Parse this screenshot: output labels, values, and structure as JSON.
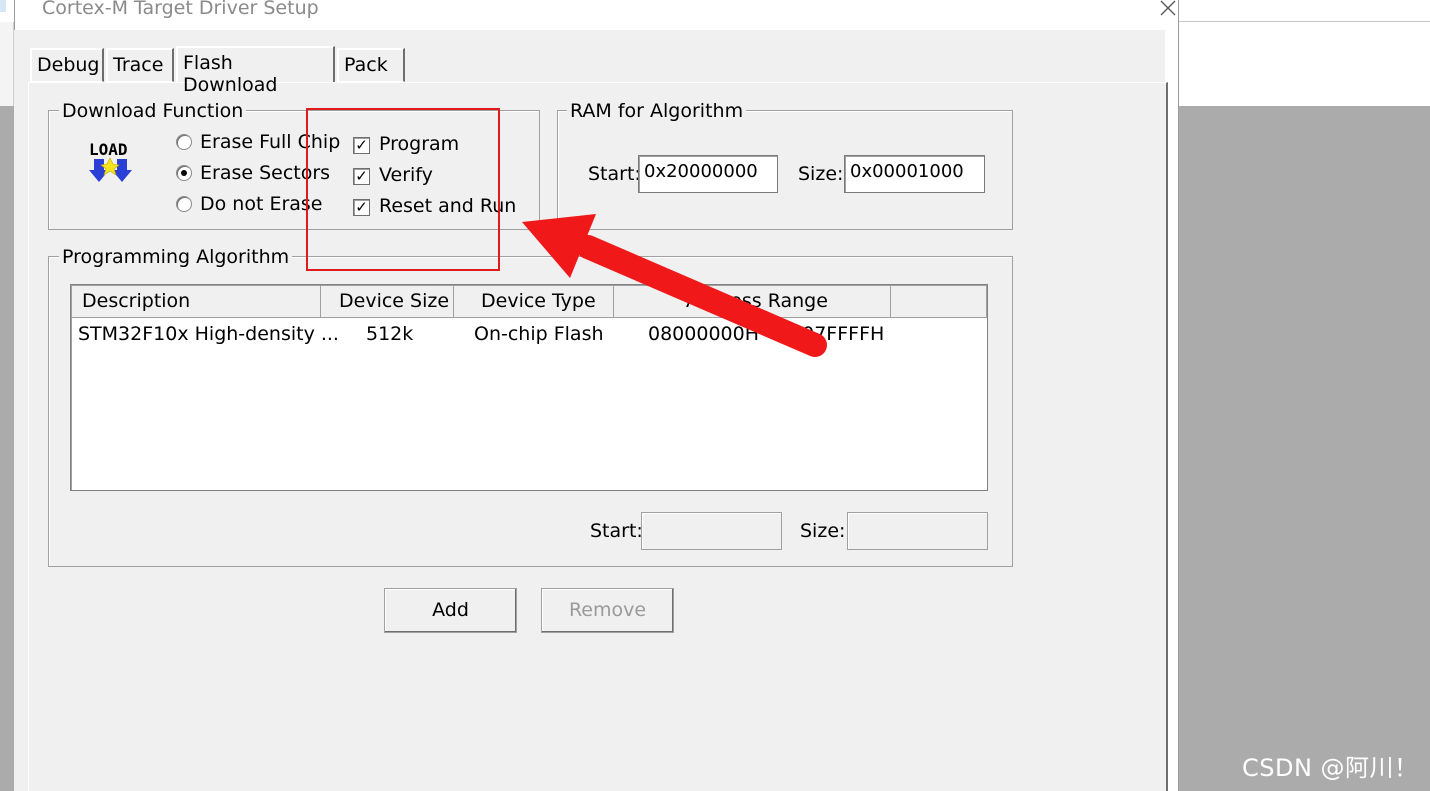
{
  "window": {
    "title": "Cortex-M Target Driver Setup"
  },
  "tabs": [
    {
      "label": "Debug"
    },
    {
      "label": "Trace"
    },
    {
      "label": "Flash Download"
    },
    {
      "label": "Pack"
    }
  ],
  "download_function": {
    "label": "Download Function",
    "icon_text": "LOAD",
    "radios": [
      {
        "label": "Erase Full Chip",
        "selected": false
      },
      {
        "label": "Erase Sectors",
        "selected": true
      },
      {
        "label": "Do not Erase",
        "selected": false
      }
    ],
    "checkboxes": [
      {
        "label": "Program",
        "checked": true
      },
      {
        "label": "Verify",
        "checked": true
      },
      {
        "label": "Reset and Run",
        "checked": true
      }
    ]
  },
  "ram_for_algorithm": {
    "label": "RAM for Algorithm",
    "start_label": "Start:",
    "start_value": "0x20000000",
    "size_label": "Size:",
    "size_value": "0x00001000"
  },
  "programming_algorithm": {
    "label": "Programming Algorithm",
    "columns": [
      "Description",
      "Device Size",
      "Device Type",
      "Address Range"
    ],
    "rows": [
      [
        "STM32F10x High-density ...",
        "512k",
        "On-chip Flash",
        "08000000H - 0807FFFFH"
      ]
    ],
    "start_label": "Start:",
    "start_value": "",
    "size_label": "Size:",
    "size_value": ""
  },
  "buttons": {
    "add": "Add",
    "remove": "Remove"
  },
  "colors": {
    "annotation": "#e11b1b",
    "dialog_face": "#f0f0f0"
  },
  "watermark": "CSDN @阿川！"
}
